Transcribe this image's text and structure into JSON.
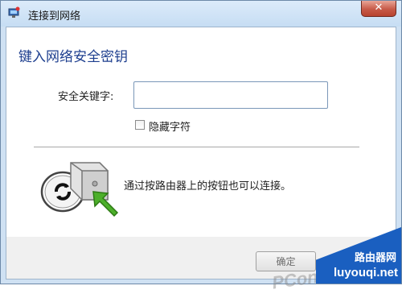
{
  "window": {
    "title": "连接到网络",
    "close_symbol": "✕"
  },
  "dialog": {
    "heading": "键入网络安全密钥",
    "security_key_label": "安全关键字:",
    "security_key_value": "",
    "hide_characters_label": "隐藏字符",
    "hide_characters_checked": false,
    "router_hint": "通过按路由器上的按钮也可以连接。",
    "ok_button_label": "确定"
  },
  "icons": {
    "title_icon": "network-icon",
    "router_icon": "router-push-button-icon"
  },
  "watermark": {
    "brand": "PConline",
    "site_name": "路由器网",
    "site_url": "luyouqi.net"
  },
  "colors": {
    "heading": "#1e3f8f",
    "titlebar": "#cfe1f3",
    "close_button": "#c75a48",
    "watermark_bg": "#1a5fc0"
  }
}
